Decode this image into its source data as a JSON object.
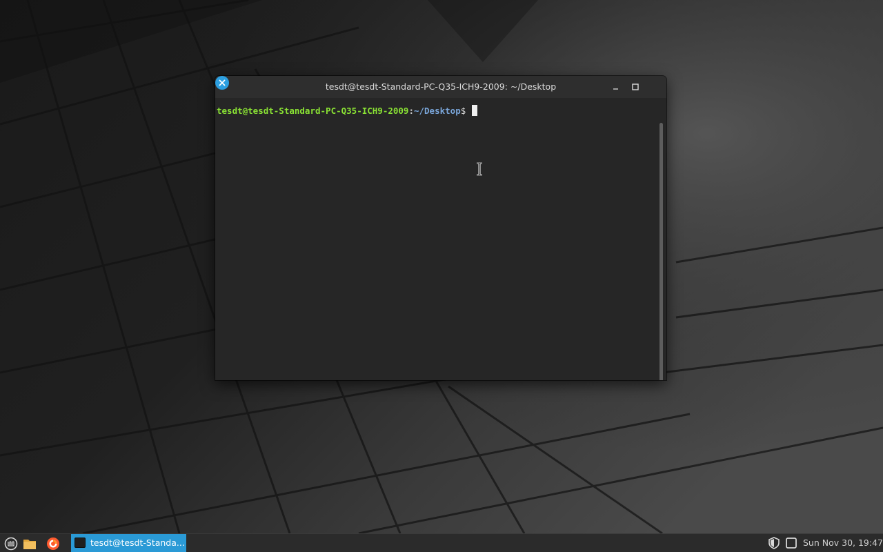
{
  "window": {
    "title": "tesdt@tesdt-Standard-PC-Q35-ICH9-2009: ~/Desktop",
    "accent": "#2c9fe0",
    "controls": {
      "minimize_icon": "minimize-icon",
      "maximize_icon": "maximize-icon",
      "close_icon": "close-icon"
    }
  },
  "terminal": {
    "prompt_user_host": "tesdt@tesdt-Standard-PC-Q35-ICH9-2009",
    "prompt_separator": ":",
    "prompt_path": "~/Desktop",
    "prompt_symbol": "$ ",
    "input": "",
    "colors": {
      "user_host": "#8ae234",
      "path": "#7aa6da",
      "background": "#262626"
    }
  },
  "taskbar": {
    "menu_icon": "linux-mint-menu-icon",
    "files_icon": "folder-icon",
    "browser_icon": "firefox-icon",
    "active_task": {
      "icon": "terminal-icon",
      "label": "tesdt@tesdt-Standa..."
    },
    "tray": {
      "icons": [
        "shield-icon",
        "window-icon"
      ],
      "clock": "Sun Nov 30, 19:47"
    },
    "accent": "#2a9ad6"
  }
}
